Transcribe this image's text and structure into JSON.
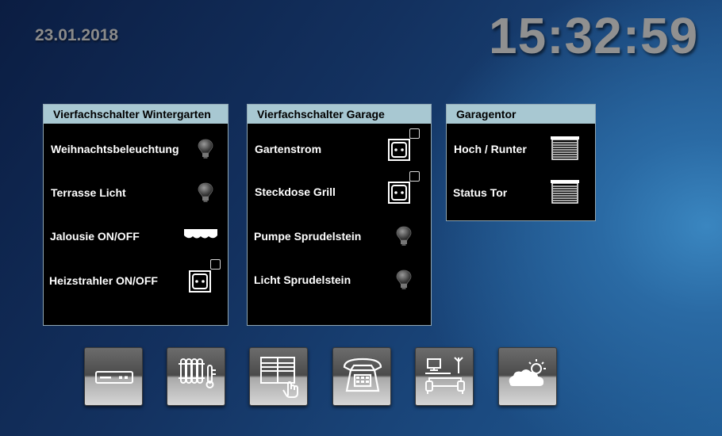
{
  "header": {
    "date": "23.01.2018",
    "time": "15:32:59"
  },
  "panels": [
    {
      "title": "Vierfachschalter Wintergarten",
      "rows": [
        {
          "label": "Weihnachtsbeleuchtung",
          "icon": "light-bulb-icon"
        },
        {
          "label": "Terrasse Licht",
          "icon": "light-bulb-icon"
        },
        {
          "label": "Jalousie ON/OFF",
          "icon": "awning-icon"
        },
        {
          "label": "Heizstrahler ON/OFF",
          "icon": "power-socket-icon"
        }
      ]
    },
    {
      "title": "Vierfachschalter Garage",
      "rows": [
        {
          "label": "Gartenstrom",
          "icon": "power-socket-icon"
        },
        {
          "label": "Steckdose Grill",
          "icon": "power-socket-icon"
        },
        {
          "label": "Pumpe Sprudelstein",
          "icon": "light-bulb-icon"
        },
        {
          "label": "Licht Sprudelstein",
          "icon": "light-bulb-icon"
        }
      ]
    },
    {
      "title": "Garagentor",
      "rows": [
        {
          "label": "Hoch / Runter",
          "icon": "shutter-icon"
        },
        {
          "label": "Status Tor",
          "icon": "shutter-icon"
        }
      ]
    }
  ],
  "nav": [
    {
      "name": "receiver",
      "icon": "receiver-icon"
    },
    {
      "name": "heating",
      "icon": "radiator-thermometer-icon"
    },
    {
      "name": "blinds",
      "icon": "window-blinds-hand-icon"
    },
    {
      "name": "phone",
      "icon": "telephone-icon"
    },
    {
      "name": "living-room",
      "icon": "living-room-icon"
    },
    {
      "name": "weather",
      "icon": "weather-cloud-sun-icon"
    }
  ],
  "colors": {
    "panel_header_bg": "#a8c8d2",
    "panel_bg": "#000000",
    "clock_text": "#909090",
    "label_text": "#ffffff"
  }
}
